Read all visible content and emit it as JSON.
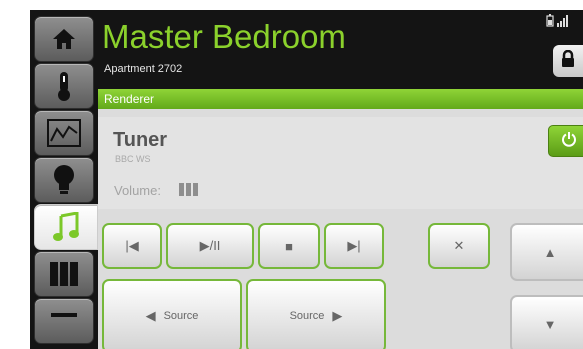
{
  "header": {
    "title": "Master Bedroom",
    "subtitle": "Apartment 2702"
  },
  "nav": {
    "items": [
      {
        "icon": "home-icon"
      },
      {
        "icon": "thermometer-icon"
      },
      {
        "icon": "chart-icon"
      },
      {
        "icon": "lightbulb-icon"
      },
      {
        "icon": "music-note-icon"
      },
      {
        "icon": "shades-icon"
      }
    ],
    "active": "music-note-icon"
  },
  "renderer": {
    "label": "Renderer",
    "source_name": "Tuner",
    "station": "BBC WS",
    "volume_label": "Volume:"
  },
  "controls": {
    "previous": "|◀",
    "play_pause": "▶/II",
    "stop": "■",
    "next": "▶|",
    "mute": "✕",
    "up": "▲",
    "down": "▼",
    "source_prev": "Source",
    "source_next": "Source"
  },
  "colors": {
    "accent": "#8bd12c",
    "background": "#141414",
    "panel": "#dcdcdc"
  }
}
